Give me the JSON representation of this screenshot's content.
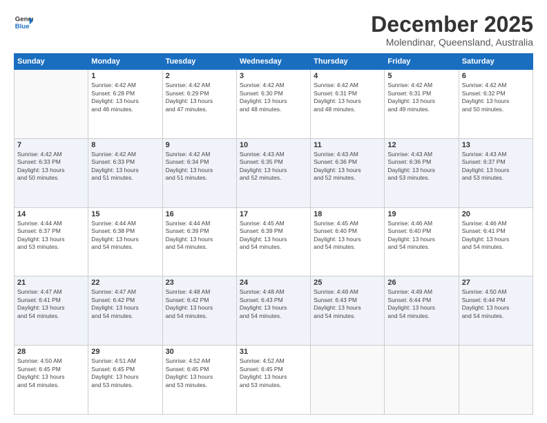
{
  "logo": {
    "line1": "General",
    "line2": "Blue"
  },
  "title": "December 2025",
  "subtitle": "Molendinar, Queensland, Australia",
  "headers": [
    "Sunday",
    "Monday",
    "Tuesday",
    "Wednesday",
    "Thursday",
    "Friday",
    "Saturday"
  ],
  "weeks": [
    [
      {
        "day": "",
        "info": ""
      },
      {
        "day": "1",
        "info": "Sunrise: 4:42 AM\nSunset: 6:28 PM\nDaylight: 13 hours\nand 46 minutes."
      },
      {
        "day": "2",
        "info": "Sunrise: 4:42 AM\nSunset: 6:29 PM\nDaylight: 13 hours\nand 47 minutes."
      },
      {
        "day": "3",
        "info": "Sunrise: 4:42 AM\nSunset: 6:30 PM\nDaylight: 13 hours\nand 48 minutes."
      },
      {
        "day": "4",
        "info": "Sunrise: 4:42 AM\nSunset: 6:31 PM\nDaylight: 13 hours\nand 48 minutes."
      },
      {
        "day": "5",
        "info": "Sunrise: 4:42 AM\nSunset: 6:31 PM\nDaylight: 13 hours\nand 49 minutes."
      },
      {
        "day": "6",
        "info": "Sunrise: 4:42 AM\nSunset: 6:32 PM\nDaylight: 13 hours\nand 50 minutes."
      }
    ],
    [
      {
        "day": "7",
        "info": "Sunrise: 4:42 AM\nSunset: 6:33 PM\nDaylight: 13 hours\nand 50 minutes."
      },
      {
        "day": "8",
        "info": "Sunrise: 4:42 AM\nSunset: 6:33 PM\nDaylight: 13 hours\nand 51 minutes."
      },
      {
        "day": "9",
        "info": "Sunrise: 4:42 AM\nSunset: 6:34 PM\nDaylight: 13 hours\nand 51 minutes."
      },
      {
        "day": "10",
        "info": "Sunrise: 4:43 AM\nSunset: 6:35 PM\nDaylight: 13 hours\nand 52 minutes."
      },
      {
        "day": "11",
        "info": "Sunrise: 4:43 AM\nSunset: 6:36 PM\nDaylight: 13 hours\nand 52 minutes."
      },
      {
        "day": "12",
        "info": "Sunrise: 4:43 AM\nSunset: 6:36 PM\nDaylight: 13 hours\nand 53 minutes."
      },
      {
        "day": "13",
        "info": "Sunrise: 4:43 AM\nSunset: 6:37 PM\nDaylight: 13 hours\nand 53 minutes."
      }
    ],
    [
      {
        "day": "14",
        "info": "Sunrise: 4:44 AM\nSunset: 6:37 PM\nDaylight: 13 hours\nand 53 minutes."
      },
      {
        "day": "15",
        "info": "Sunrise: 4:44 AM\nSunset: 6:38 PM\nDaylight: 13 hours\nand 54 minutes."
      },
      {
        "day": "16",
        "info": "Sunrise: 4:44 AM\nSunset: 6:39 PM\nDaylight: 13 hours\nand 54 minutes."
      },
      {
        "day": "17",
        "info": "Sunrise: 4:45 AM\nSunset: 6:39 PM\nDaylight: 13 hours\nand 54 minutes."
      },
      {
        "day": "18",
        "info": "Sunrise: 4:45 AM\nSunset: 6:40 PM\nDaylight: 13 hours\nand 54 minutes."
      },
      {
        "day": "19",
        "info": "Sunrise: 4:46 AM\nSunset: 6:40 PM\nDaylight: 13 hours\nand 54 minutes."
      },
      {
        "day": "20",
        "info": "Sunrise: 4:46 AM\nSunset: 6:41 PM\nDaylight: 13 hours\nand 54 minutes."
      }
    ],
    [
      {
        "day": "21",
        "info": "Sunrise: 4:47 AM\nSunset: 6:41 PM\nDaylight: 13 hours\nand 54 minutes."
      },
      {
        "day": "22",
        "info": "Sunrise: 4:47 AM\nSunset: 6:42 PM\nDaylight: 13 hours\nand 54 minutes."
      },
      {
        "day": "23",
        "info": "Sunrise: 4:48 AM\nSunset: 6:42 PM\nDaylight: 13 hours\nand 54 minutes."
      },
      {
        "day": "24",
        "info": "Sunrise: 4:48 AM\nSunset: 6:43 PM\nDaylight: 13 hours\nand 54 minutes."
      },
      {
        "day": "25",
        "info": "Sunrise: 4:49 AM\nSunset: 6:43 PM\nDaylight: 13 hours\nand 54 minutes."
      },
      {
        "day": "26",
        "info": "Sunrise: 4:49 AM\nSunset: 6:44 PM\nDaylight: 13 hours\nand 54 minutes."
      },
      {
        "day": "27",
        "info": "Sunrise: 4:50 AM\nSunset: 6:44 PM\nDaylight: 13 hours\nand 54 minutes."
      }
    ],
    [
      {
        "day": "28",
        "info": "Sunrise: 4:50 AM\nSunset: 6:45 PM\nDaylight: 13 hours\nand 54 minutes."
      },
      {
        "day": "29",
        "info": "Sunrise: 4:51 AM\nSunset: 6:45 PM\nDaylight: 13 hours\nand 53 minutes."
      },
      {
        "day": "30",
        "info": "Sunrise: 4:52 AM\nSunset: 6:45 PM\nDaylight: 13 hours\nand 53 minutes."
      },
      {
        "day": "31",
        "info": "Sunrise: 4:52 AM\nSunset: 6:45 PM\nDaylight: 13 hours\nand 53 minutes."
      },
      {
        "day": "",
        "info": ""
      },
      {
        "day": "",
        "info": ""
      },
      {
        "day": "",
        "info": ""
      }
    ]
  ]
}
